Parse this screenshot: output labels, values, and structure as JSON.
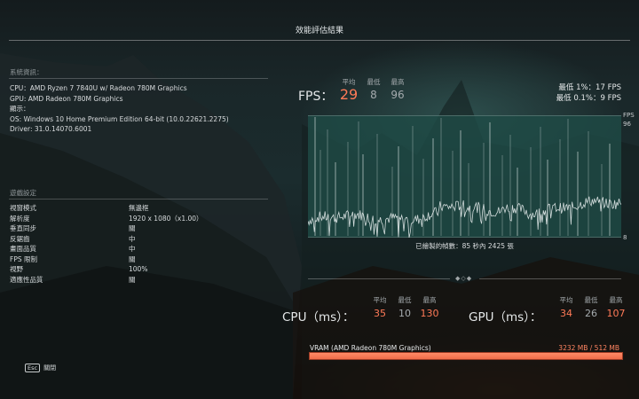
{
  "title": "效能評估結果",
  "system": {
    "header": "系統資訊：",
    "cpu": "CPU：AMD Ryzen 7 7840U w/ Radeon 780M Graphics",
    "gpu": "GPU: AMD Radeon 780M Graphics",
    "display": "顯示：",
    "os": "OS: Windows 10 Home Premium Edition 64-bit (10.0.22621.2275)",
    "driver": "Driver: 31.0.14070.6001"
  },
  "game_settings": {
    "header": "遊戲設定",
    "rows": [
      {
        "key": "視窗模式",
        "value": "無邊框"
      },
      {
        "key": "解析度",
        "value": "1920 x 1080（x1.00）"
      },
      {
        "key": "垂直同步",
        "value": "關"
      },
      {
        "key": "反鋸齒",
        "value": "中"
      },
      {
        "key": "畫面品質",
        "value": "中"
      },
      {
        "key": "FPS 限制",
        "value": "關"
      },
      {
        "key": "視野",
        "value": "100%"
      },
      {
        "key": "適應性品質",
        "value": "關"
      }
    ]
  },
  "fps": {
    "label": "FPS：",
    "avg_label": "平均",
    "min_label": "最低",
    "max_label": "最高",
    "avg": "29",
    "min": "8",
    "max": "96",
    "low1": "最低 1%：17 FPS",
    "low01": "最低 0.1%：9 FPS",
    "axis_unit": "FPS",
    "axis_max": "96",
    "axis_min": "8",
    "frames_text": "已繪製的幀數：85 秒內 2425 張"
  },
  "cpu": {
    "label": "CPU（ms）：",
    "avg_label": "平均",
    "min_label": "最低",
    "max_label": "最高",
    "avg": "35",
    "min": "10",
    "max": "130"
  },
  "gpu": {
    "label": "GPU（ms）：",
    "avg_label": "平均",
    "min_label": "最低",
    "max_label": "最高",
    "avg": "34",
    "min": "26",
    "max": "107"
  },
  "vram": {
    "label": "VRAM (AMD Radeon 780M Graphics)",
    "value": "3232 MB / 512 MB",
    "fill_fraction": 1.0
  },
  "close": {
    "key": "Esc",
    "label": "關閉"
  },
  "colors": {
    "accent": "#ff7a57",
    "graph_bg": "#1f4a45",
    "graph_line": "#e6ecec"
  },
  "icons": {
    "ornament": "diamond-ornament-icon"
  }
}
